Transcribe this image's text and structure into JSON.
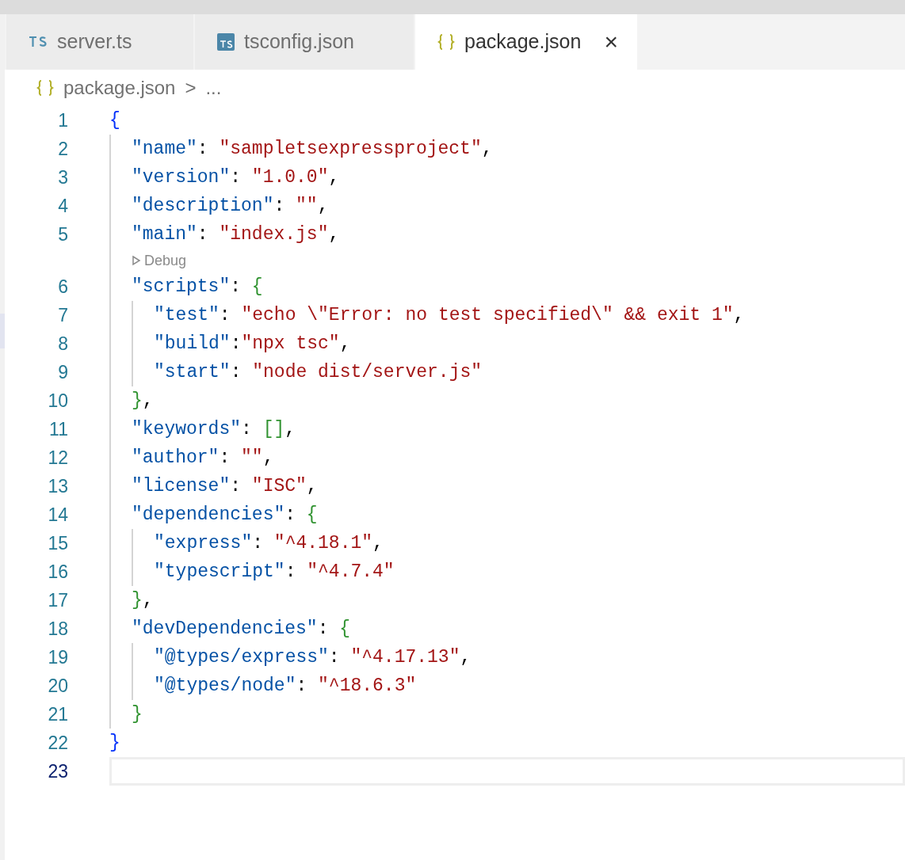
{
  "tabs": [
    {
      "label": "server.ts",
      "kind": "ts-text",
      "selected": false
    },
    {
      "label": "tsconfig.json",
      "kind": "ts-box",
      "selected": false
    },
    {
      "label": "package.json",
      "kind": "braces",
      "selected": true,
      "close": "×"
    }
  ],
  "breadcrumb": {
    "file": "package.json",
    "separator": ">",
    "more": "..."
  },
  "lines": [
    {
      "number": "1",
      "selected": false,
      "tokens": [
        {
          "kind": "brace1",
          "text": "{"
        }
      ],
      "children": [
        {
          "number": "2",
          "selected": false,
          "tokens": [
            {
              "kind": "key",
              "text": "\"name\""
            },
            {
              "kind": "punct",
              "text": ": "
            },
            {
              "kind": "string",
              "text": "\"sampletsexpressproject\""
            },
            {
              "kind": "punct",
              "text": ","
            }
          ]
        },
        {
          "number": "3",
          "selected": false,
          "tokens": [
            {
              "kind": "key",
              "text": "\"version\""
            },
            {
              "kind": "punct",
              "text": ": "
            },
            {
              "kind": "string",
              "text": "\"1.0.0\""
            },
            {
              "kind": "punct",
              "text": ","
            }
          ]
        },
        {
          "number": "4",
          "selected": false,
          "tokens": [
            {
              "kind": "key",
              "text": "\"description\""
            },
            {
              "kind": "punct",
              "text": ": "
            },
            {
              "kind": "string",
              "text": "\"\""
            },
            {
              "kind": "punct",
              "text": ","
            }
          ]
        },
        {
          "number": "5",
          "selected": false,
          "tokens": [
            {
              "kind": "key",
              "text": "\"main\""
            },
            {
              "kind": "punct",
              "text": ": "
            },
            {
              "kind": "string",
              "text": "\"index.js\""
            },
            {
              "kind": "punct",
              "text": ","
            }
          ]
        },
        {
          "number": "6",
          "selected": false,
          "codelens": "Debug",
          "tokens": [
            {
              "kind": "key",
              "text": "\"scripts\""
            },
            {
              "kind": "punct",
              "text": ": "
            },
            {
              "kind": "brace2",
              "text": "{"
            }
          ],
          "children": [
            {
              "number": "7",
              "selected": false,
              "tokens": [
                {
                  "kind": "key",
                  "text": "\"test\""
                },
                {
                  "kind": "punct",
                  "text": ": "
                },
                {
                  "kind": "string",
                  "text": "\"echo \\\"Error: no test specified\\\" && exit 1\""
                },
                {
                  "kind": "punct",
                  "text": ","
                }
              ]
            },
            {
              "number": "8",
              "selected": false,
              "tokens": [
                {
                  "kind": "key",
                  "text": "\"build\""
                },
                {
                  "kind": "punct",
                  "text": ":"
                },
                {
                  "kind": "string",
                  "text": "\"npx tsc\""
                },
                {
                  "kind": "punct",
                  "text": ","
                }
              ]
            },
            {
              "number": "9",
              "selected": false,
              "tokens": [
                {
                  "kind": "key",
                  "text": "\"start\""
                },
                {
                  "kind": "punct",
                  "text": ": "
                },
                {
                  "kind": "string",
                  "text": "\"node dist/server.js\""
                }
              ]
            }
          ]
        },
        {
          "number": "10",
          "selected": false,
          "tokens": [
            {
              "kind": "brace2",
              "text": "}"
            },
            {
              "kind": "punct",
              "text": ","
            }
          ]
        },
        {
          "number": "11",
          "selected": false,
          "tokens": [
            {
              "kind": "key",
              "text": "\"keywords\""
            },
            {
              "kind": "punct",
              "text": ": "
            },
            {
              "kind": "brace2",
              "text": "[]"
            },
            {
              "kind": "punct",
              "text": ","
            }
          ]
        },
        {
          "number": "12",
          "selected": false,
          "tokens": [
            {
              "kind": "key",
              "text": "\"author\""
            },
            {
              "kind": "punct",
              "text": ": "
            },
            {
              "kind": "string",
              "text": "\"\""
            },
            {
              "kind": "punct",
              "text": ","
            }
          ]
        },
        {
          "number": "13",
          "selected": false,
          "tokens": [
            {
              "kind": "key",
              "text": "\"license\""
            },
            {
              "kind": "punct",
              "text": ": "
            },
            {
              "kind": "string",
              "text": "\"ISC\""
            },
            {
              "kind": "punct",
              "text": ","
            }
          ]
        },
        {
          "number": "14",
          "selected": false,
          "tokens": [
            {
              "kind": "key",
              "text": "\"dependencies\""
            },
            {
              "kind": "punct",
              "text": ": "
            },
            {
              "kind": "brace2",
              "text": "{"
            }
          ],
          "children": [
            {
              "number": "15",
              "selected": false,
              "tokens": [
                {
                  "kind": "key",
                  "text": "\"express\""
                },
                {
                  "kind": "punct",
                  "text": ": "
                },
                {
                  "kind": "string",
                  "text": "\"^4.18.1\""
                },
                {
                  "kind": "punct",
                  "text": ","
                }
              ]
            },
            {
              "number": "16",
              "selected": false,
              "tokens": [
                {
                  "kind": "key",
                  "text": "\"typescript\""
                },
                {
                  "kind": "punct",
                  "text": ": "
                },
                {
                  "kind": "string",
                  "text": "\"^4.7.4\""
                }
              ]
            }
          ]
        },
        {
          "number": "17",
          "selected": false,
          "tokens": [
            {
              "kind": "brace2",
              "text": "}"
            },
            {
              "kind": "punct",
              "text": ","
            }
          ]
        },
        {
          "number": "18",
          "selected": false,
          "tokens": [
            {
              "kind": "key",
              "text": "\"devDependencies\""
            },
            {
              "kind": "punct",
              "text": ": "
            },
            {
              "kind": "brace2",
              "text": "{"
            }
          ],
          "children": [
            {
              "number": "19",
              "selected": false,
              "tokens": [
                {
                  "kind": "key",
                  "text": "\"@types/express\""
                },
                {
                  "kind": "punct",
                  "text": ": "
                },
                {
                  "kind": "string",
                  "text": "\"^4.17.13\""
                },
                {
                  "kind": "punct",
                  "text": ","
                }
              ]
            },
            {
              "number": "20",
              "selected": false,
              "tokens": [
                {
                  "kind": "key",
                  "text": "\"@types/node\""
                },
                {
                  "kind": "punct",
                  "text": ": "
                },
                {
                  "kind": "string",
                  "text": "\"^18.6.3\""
                }
              ]
            }
          ]
        },
        {
          "number": "21",
          "selected": false,
          "tokens": [
            {
              "kind": "brace2",
              "text": "}"
            }
          ]
        }
      ]
    },
    {
      "number": "22",
      "selected": false,
      "tokens": [
        {
          "kind": "brace1",
          "text": "}"
        }
      ]
    },
    {
      "number": "23",
      "selected": true
    }
  ]
}
